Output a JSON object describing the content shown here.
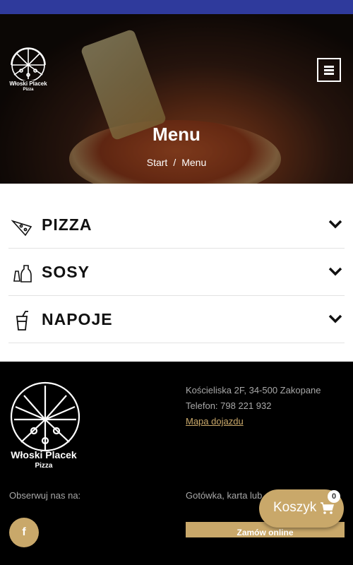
{
  "brand": {
    "name": "Włoski Placek",
    "sub": "Pizza"
  },
  "hero": {
    "title": "Menu",
    "breadcrumb": {
      "home": "Start",
      "separator": "/",
      "current": "Menu"
    }
  },
  "menu": {
    "categories": [
      {
        "label": "PIZZA",
        "icon": "pizza-slice-icon"
      },
      {
        "label": "SOSY",
        "icon": "sauce-bottle-icon"
      },
      {
        "label": "NAPOJE",
        "icon": "drink-cup-icon"
      }
    ]
  },
  "footer": {
    "address": "Kościeliska 2F, 34-500 Zakopane",
    "phone": "Telefon: 798 221 932",
    "map_link": "Mapa dojazdu",
    "follow": "Obserwuj nas na:",
    "payment": "Gotówka, karta lub",
    "order_button": "Zamów online",
    "facebook": "f"
  },
  "cart": {
    "label": "Koszyk",
    "count": "0"
  },
  "colors": {
    "accent": "#c9a86a",
    "topbar": "#2f3a9c",
    "footer_bg": "#000000"
  }
}
